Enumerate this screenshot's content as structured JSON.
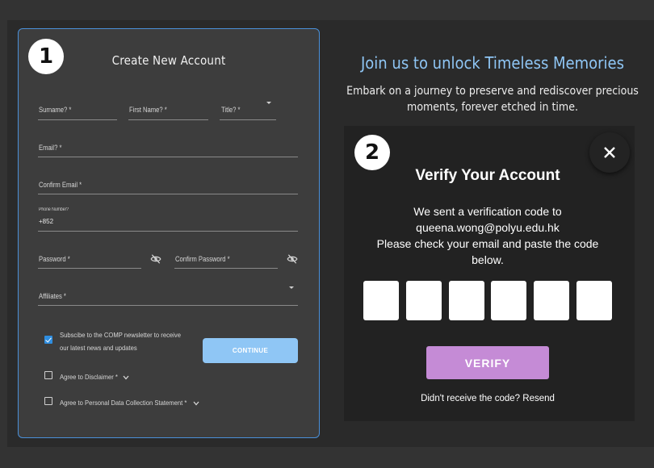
{
  "badges": {
    "one": "1",
    "two": "2"
  },
  "form": {
    "title": "Create New Account",
    "surname_label": "Surname? *",
    "firstname_label": "First Name? *",
    "title_label": "Title? *",
    "email_label": "Email? *",
    "confirm_email_label": "Confirm Email *",
    "phone_label": "Phone Number?",
    "phone_value": "+852",
    "password_label": "Password *",
    "confirm_password_label": "Confirm Password *",
    "affiliates_label": "Affiliates *",
    "newsletter_line1": "Subscibe to the COMP newsletter to receive",
    "newsletter_line2": "our latest news and updates",
    "newsletter_checked": true,
    "disclaimer_label": "Agree to Disclaimer *",
    "disclaimer_checked": false,
    "personal_data_label": "Agree to Personal Data Collection Statement *",
    "personal_data_checked": false,
    "continue_label": "CONTINUE"
  },
  "hero": {
    "title": "Join us to unlock Timeless Memories",
    "subtitle_line1": "Embark on a journey to preserve and rediscover precious",
    "subtitle_line2": "moments, forever etched in time."
  },
  "verify": {
    "close_icon": "close-icon",
    "title": "Verify Your Account",
    "line1": "We sent a verification code to",
    "email": "queena.wong@polyu.edu.hk",
    "line3": "Please check your email and paste the code",
    "line4": "below.",
    "code_digits": [
      "",
      "",
      "",
      "",
      "",
      ""
    ],
    "button_label": "VERIFY",
    "resend_text": "Didn't receive the code? Resend"
  },
  "colors": {
    "accent_blue": "#8fc6f5",
    "verify_purple": "#c58bd6",
    "card_border": "#4a90d9"
  }
}
